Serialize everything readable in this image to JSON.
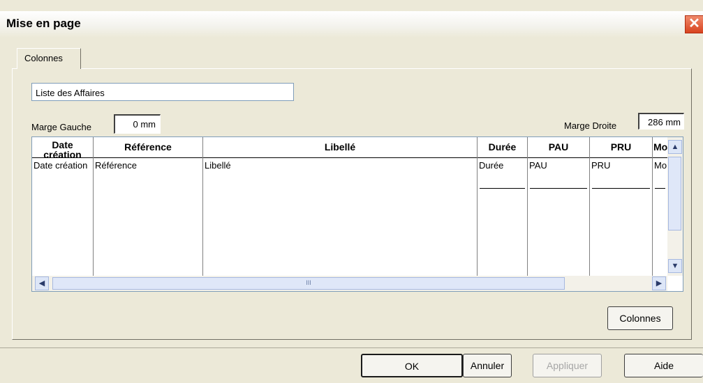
{
  "window": {
    "title": "Mise en page",
    "close_glyph": "✕"
  },
  "tabs": [
    {
      "label": "Colonnes",
      "active": true
    }
  ],
  "title_field": {
    "value": "Liste des Affaires"
  },
  "margins": {
    "left_label": "Marge Gauche",
    "left_value": "0 mm",
    "right_label": "Marge Droite",
    "right_value": "286 mm"
  },
  "grid": {
    "columns": [
      {
        "header": "Date création",
        "cell": "Date création"
      },
      {
        "header": "Référence",
        "cell": "Référence"
      },
      {
        "header": "Libellé",
        "cell": "Libellé"
      },
      {
        "header": "Durée",
        "cell": "Durée"
      },
      {
        "header": "PAU",
        "cell": "PAU"
      },
      {
        "header": "PRU",
        "cell": "PRU"
      },
      {
        "header": "Mo",
        "cell": "Mo"
      }
    ],
    "hscroll_grip": "III"
  },
  "buttons": {
    "colonnes": "Colonnes",
    "ok": "OK",
    "annuler": "Annuler",
    "appliquer": "Appliquer",
    "aide": "Aide"
  },
  "colors": {
    "face": "#ece9d8",
    "close": "#d8431f",
    "scroll": "#dfe7f8"
  }
}
